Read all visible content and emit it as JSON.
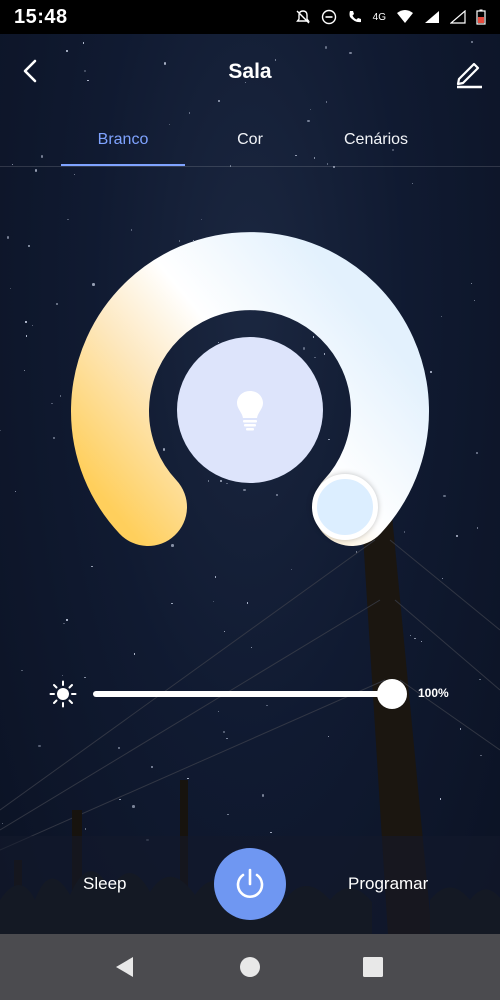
{
  "status_bar": {
    "time": "15:48",
    "network_label": "4G"
  },
  "header": {
    "title": "Sala"
  },
  "tabs": [
    {
      "label": "Branco",
      "active": true
    },
    {
      "label": "Cor",
      "active": false
    },
    {
      "label": "Cenários",
      "active": false
    }
  ],
  "brightness": {
    "label": "100%",
    "value": 1.0
  },
  "bottom": {
    "sleep_label": "Sleep",
    "schedule_label": "Programar"
  },
  "colors": {
    "accent": "#7fa3ff",
    "power": "#6f97f2",
    "bulb_circle": "#dde4fb",
    "warm": "#ffcf5c",
    "cool": "#e3f1fd"
  }
}
